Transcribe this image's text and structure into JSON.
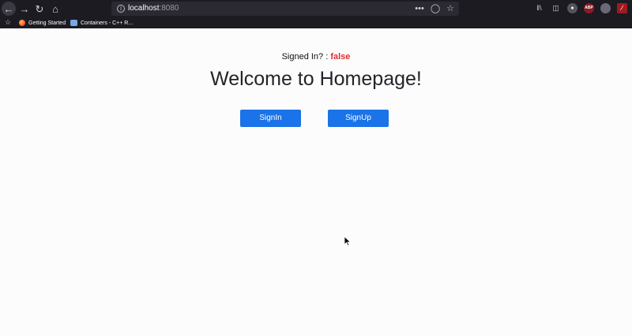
{
  "browser": {
    "url_host": "localhost",
    "url_port": ":8080",
    "bookmarks": [
      {
        "label": "Getting Started"
      },
      {
        "label": "Containers - C++ R..."
      }
    ]
  },
  "page": {
    "signed_in_label": "Signed In? :",
    "signed_in_value": "false",
    "heading": "Welcome to Homepage!",
    "signin_label": "SignIn",
    "signup_label": "SignUp"
  },
  "colors": {
    "accent": "#1a73e8",
    "false_value": "#e02f2f",
    "chrome_bg": "#1c1b22"
  }
}
